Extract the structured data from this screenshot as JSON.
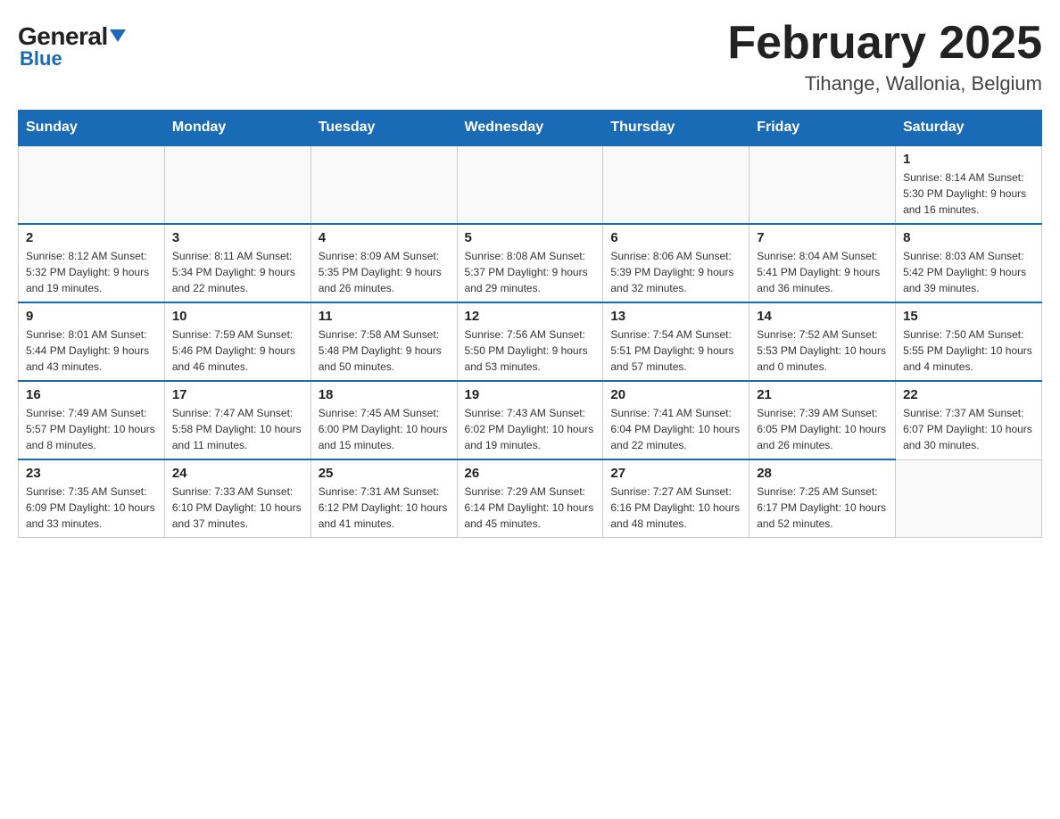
{
  "header": {
    "logo_general": "General",
    "logo_blue": "Blue",
    "month_title": "February 2025",
    "location": "Tihange, Wallonia, Belgium"
  },
  "weekdays": [
    "Sunday",
    "Monday",
    "Tuesday",
    "Wednesday",
    "Thursday",
    "Friday",
    "Saturday"
  ],
  "weeks": [
    [
      {
        "day": "",
        "info": ""
      },
      {
        "day": "",
        "info": ""
      },
      {
        "day": "",
        "info": ""
      },
      {
        "day": "",
        "info": ""
      },
      {
        "day": "",
        "info": ""
      },
      {
        "day": "",
        "info": ""
      },
      {
        "day": "1",
        "info": "Sunrise: 8:14 AM\nSunset: 5:30 PM\nDaylight: 9 hours and 16 minutes."
      }
    ],
    [
      {
        "day": "2",
        "info": "Sunrise: 8:12 AM\nSunset: 5:32 PM\nDaylight: 9 hours and 19 minutes."
      },
      {
        "day": "3",
        "info": "Sunrise: 8:11 AM\nSunset: 5:34 PM\nDaylight: 9 hours and 22 minutes."
      },
      {
        "day": "4",
        "info": "Sunrise: 8:09 AM\nSunset: 5:35 PM\nDaylight: 9 hours and 26 minutes."
      },
      {
        "day": "5",
        "info": "Sunrise: 8:08 AM\nSunset: 5:37 PM\nDaylight: 9 hours and 29 minutes."
      },
      {
        "day": "6",
        "info": "Sunrise: 8:06 AM\nSunset: 5:39 PM\nDaylight: 9 hours and 32 minutes."
      },
      {
        "day": "7",
        "info": "Sunrise: 8:04 AM\nSunset: 5:41 PM\nDaylight: 9 hours and 36 minutes."
      },
      {
        "day": "8",
        "info": "Sunrise: 8:03 AM\nSunset: 5:42 PM\nDaylight: 9 hours and 39 minutes."
      }
    ],
    [
      {
        "day": "9",
        "info": "Sunrise: 8:01 AM\nSunset: 5:44 PM\nDaylight: 9 hours and 43 minutes."
      },
      {
        "day": "10",
        "info": "Sunrise: 7:59 AM\nSunset: 5:46 PM\nDaylight: 9 hours and 46 minutes."
      },
      {
        "day": "11",
        "info": "Sunrise: 7:58 AM\nSunset: 5:48 PM\nDaylight: 9 hours and 50 minutes."
      },
      {
        "day": "12",
        "info": "Sunrise: 7:56 AM\nSunset: 5:50 PM\nDaylight: 9 hours and 53 minutes."
      },
      {
        "day": "13",
        "info": "Sunrise: 7:54 AM\nSunset: 5:51 PM\nDaylight: 9 hours and 57 minutes."
      },
      {
        "day": "14",
        "info": "Sunrise: 7:52 AM\nSunset: 5:53 PM\nDaylight: 10 hours and 0 minutes."
      },
      {
        "day": "15",
        "info": "Sunrise: 7:50 AM\nSunset: 5:55 PM\nDaylight: 10 hours and 4 minutes."
      }
    ],
    [
      {
        "day": "16",
        "info": "Sunrise: 7:49 AM\nSunset: 5:57 PM\nDaylight: 10 hours and 8 minutes."
      },
      {
        "day": "17",
        "info": "Sunrise: 7:47 AM\nSunset: 5:58 PM\nDaylight: 10 hours and 11 minutes."
      },
      {
        "day": "18",
        "info": "Sunrise: 7:45 AM\nSunset: 6:00 PM\nDaylight: 10 hours and 15 minutes."
      },
      {
        "day": "19",
        "info": "Sunrise: 7:43 AM\nSunset: 6:02 PM\nDaylight: 10 hours and 19 minutes."
      },
      {
        "day": "20",
        "info": "Sunrise: 7:41 AM\nSunset: 6:04 PM\nDaylight: 10 hours and 22 minutes."
      },
      {
        "day": "21",
        "info": "Sunrise: 7:39 AM\nSunset: 6:05 PM\nDaylight: 10 hours and 26 minutes."
      },
      {
        "day": "22",
        "info": "Sunrise: 7:37 AM\nSunset: 6:07 PM\nDaylight: 10 hours and 30 minutes."
      }
    ],
    [
      {
        "day": "23",
        "info": "Sunrise: 7:35 AM\nSunset: 6:09 PM\nDaylight: 10 hours and 33 minutes."
      },
      {
        "day": "24",
        "info": "Sunrise: 7:33 AM\nSunset: 6:10 PM\nDaylight: 10 hours and 37 minutes."
      },
      {
        "day": "25",
        "info": "Sunrise: 7:31 AM\nSunset: 6:12 PM\nDaylight: 10 hours and 41 minutes."
      },
      {
        "day": "26",
        "info": "Sunrise: 7:29 AM\nSunset: 6:14 PM\nDaylight: 10 hours and 45 minutes."
      },
      {
        "day": "27",
        "info": "Sunrise: 7:27 AM\nSunset: 6:16 PM\nDaylight: 10 hours and 48 minutes."
      },
      {
        "day": "28",
        "info": "Sunrise: 7:25 AM\nSunset: 6:17 PM\nDaylight: 10 hours and 52 minutes."
      },
      {
        "day": "",
        "info": ""
      }
    ]
  ]
}
